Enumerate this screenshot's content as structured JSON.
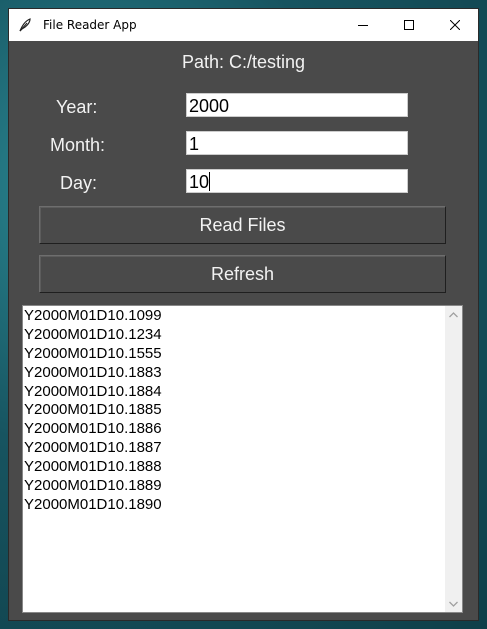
{
  "window": {
    "title": "File Reader App"
  },
  "path_label": "Path: C:/testing",
  "form": {
    "year_label": "Year:",
    "year_value": "2000",
    "month_label": "Month:",
    "month_value": "1",
    "day_label": "Day:",
    "day_value": "10"
  },
  "buttons": {
    "read": "Read Files",
    "refresh": "Refresh"
  },
  "files": [
    "Y2000M01D10.1099",
    "Y2000M01D10.1234",
    "Y2000M01D10.1555",
    "Y2000M01D10.1883",
    "Y2000M01D10.1884",
    "Y2000M01D10.1885",
    "Y2000M01D10.1886",
    "Y2000M01D10.1887",
    "Y2000M01D10.1888",
    "Y2000M01D10.1889",
    "Y2000M01D10.1890"
  ],
  "icons": {
    "app": "feather-icon",
    "minimize": "minimize-icon",
    "maximize": "maximize-icon",
    "close": "close-icon",
    "scroll_up": "scroll-up-arrow-icon",
    "scroll_down": "scroll-down-arrow-icon"
  }
}
